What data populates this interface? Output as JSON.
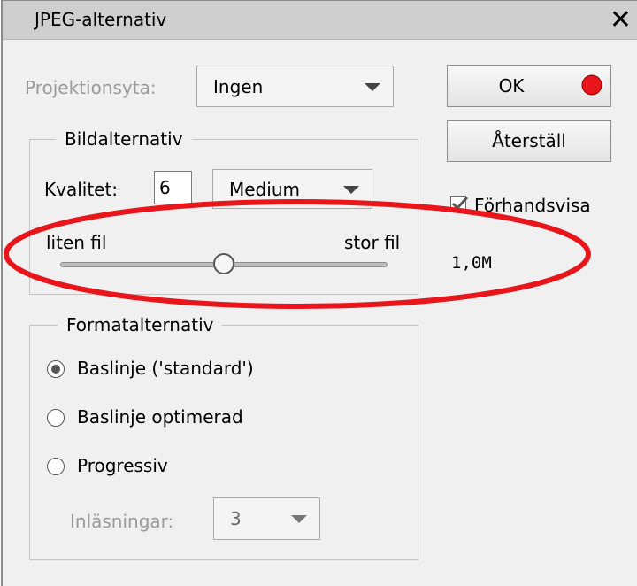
{
  "window": {
    "title": "JPEG-alternativ"
  },
  "projection": {
    "label": "Projektionsyta:",
    "value": "Ingen"
  },
  "buttons": {
    "ok": "OK",
    "reset": "Återställ"
  },
  "preview": {
    "label": "Förhandsvisa",
    "checked": true,
    "file_size": "1,0M"
  },
  "image_options": {
    "legend": "Bildalternativ",
    "quality_label": "Kvalitet:",
    "quality_value": "6",
    "quality_preset": "Medium",
    "slider_min_label": "liten fil",
    "slider_max_label": "stor fil",
    "slider_fraction": 0.5
  },
  "format_options": {
    "legend": "Formatalternativ",
    "options": [
      {
        "label": "Baslinje ('standard')",
        "selected": true
      },
      {
        "label": "Baslinje optimerad",
        "selected": false
      },
      {
        "label": "Progressiv",
        "selected": false
      }
    ],
    "scans_label": "Inläsningar:",
    "scans_value": "3"
  },
  "annotation_colors": {
    "ellipse": "#e8151b",
    "dot": "#e8151b"
  }
}
